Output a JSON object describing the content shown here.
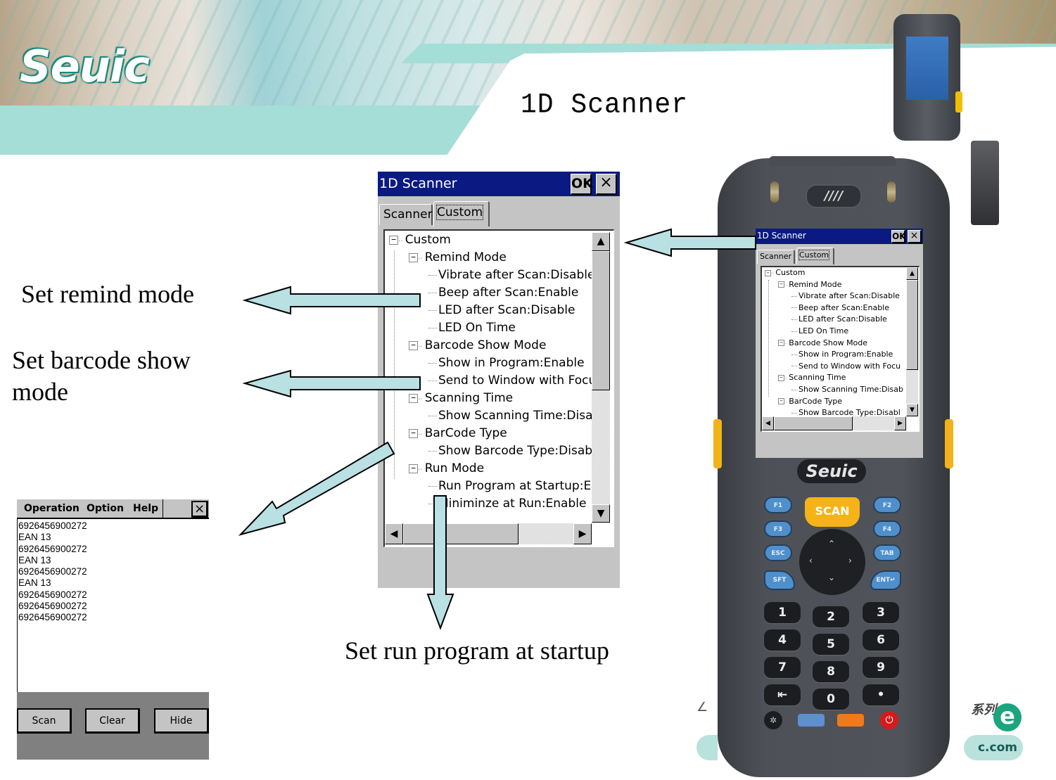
{
  "slide": {
    "logo_text": "Seuic",
    "title": "1D Scanner"
  },
  "main_dialog": {
    "title": "1D Scanner",
    "ok_label": "OK",
    "close_label": "×",
    "tabs": [
      {
        "label": "Scanner",
        "active": false
      },
      {
        "label": "Custom",
        "active": true
      }
    ],
    "tree": [
      {
        "label": "Custom",
        "level": 0,
        "expander": "⊟"
      },
      {
        "label": "Remind Mode",
        "level": 1,
        "expander": "⊟"
      },
      {
        "label": "Vibrate after Scan:Disable",
        "level": 2
      },
      {
        "label": "Beep after Scan:Enable",
        "level": 2
      },
      {
        "label": "LED after Scan:Disable",
        "level": 2
      },
      {
        "label": "LED On Time",
        "level": 2
      },
      {
        "label": "Barcode Show Mode",
        "level": 1,
        "expander": "⊟"
      },
      {
        "label": "Show in Program:Enable",
        "level": 2
      },
      {
        "label": "Send to Window with Focu",
        "level": 2
      },
      {
        "label": "Scanning Time",
        "level": 1,
        "expander": "⊟"
      },
      {
        "label": "Show Scanning Time:Disab",
        "level": 2
      },
      {
        "label": "BarCode Type",
        "level": 1,
        "expander": "⊟"
      },
      {
        "label": "Show Barcode Type:Disabl",
        "level": 2
      },
      {
        "label": "Run Mode",
        "level": 1,
        "expander": "⊟"
      },
      {
        "label": "Run Program at Startup:En",
        "level": 2
      },
      {
        "label": "Miniminze at Run:Enable",
        "level": 2
      }
    ],
    "scroll_up_icon": "▲",
    "scroll_down_icon": "▼",
    "scroll_left_icon": "◀",
    "scroll_right_icon": "▶"
  },
  "device_dialog": {
    "title": "1D Scanner",
    "ok_label": "OK",
    "close_label": "×",
    "tabs": [
      {
        "label": "Scanner",
        "active": false
      },
      {
        "label": "Custom",
        "active": true
      }
    ],
    "tree": [
      {
        "label": "Custom",
        "level": 0,
        "expander": "⊟"
      },
      {
        "label": "Remind Mode",
        "level": 1,
        "expander": "⊟"
      },
      {
        "label": "Vibrate after Scan:Disable",
        "level": 2
      },
      {
        "label": "Beep after Scan:Enable",
        "level": 2
      },
      {
        "label": "LED after Scan:Disable",
        "level": 2
      },
      {
        "label": "LED On Time",
        "level": 2
      },
      {
        "label": "Barcode Show Mode",
        "level": 1,
        "expander": "⊟"
      },
      {
        "label": "Show in Program:Enable",
        "level": 2
      },
      {
        "label": "Send to Window with Focu",
        "level": 2
      },
      {
        "label": "Scanning Time",
        "level": 1,
        "expander": "⊟"
      },
      {
        "label": "Show Scanning Time:Disab",
        "level": 2
      },
      {
        "label": "BarCode Type",
        "level": 1,
        "expander": "⊟"
      },
      {
        "label": "Show Barcode Type:Disabl",
        "level": 2
      }
    ]
  },
  "callouts": {
    "remind": "Set remind mode",
    "barcode_show_line1": "Set barcode show",
    "barcode_show_line2": "mode",
    "run_program": "Set run program at startup"
  },
  "scan_app": {
    "menu": [
      "Operation",
      "Option",
      "Help"
    ],
    "close_label": "×",
    "output_lines": [
      "6926456900272",
      "EAN 13",
      "6926456900272",
      "EAN 13",
      "6926456900272",
      "EAN 13",
      "6926456900272",
      "6926456900272",
      "6926456900272"
    ],
    "buttons": {
      "scan": "Scan",
      "clear": "Clear",
      "hide": "Hide"
    }
  },
  "device": {
    "brand": "Seuic",
    "speaker_glyph": "////",
    "keys": {
      "f1": "F1",
      "f2": "F2",
      "f3": "F3",
      "f4": "F4",
      "esc": "ESC",
      "tab": "TAB",
      "sft": "SFT",
      "ent": "ENT↵",
      "scan": "SCAN",
      "digits": [
        "1",
        "2",
        "3",
        "4",
        "5",
        "6",
        "7",
        "8",
        "9",
        "⇤",
        "0",
        "•"
      ]
    },
    "key_colors": {
      "blue": "#4f8fcc",
      "orange": "#f07a1a",
      "power": "#d41a1a",
      "scan": "#f5b318"
    }
  },
  "footer_brand": {
    "url_fragment": "c.com",
    "e_logo": "e",
    "series_mark": "系列"
  },
  "colors": {
    "arrow_fill": "#b9e0e3",
    "banner_teal": "#a4ded6",
    "wince_title": "#0a1a82",
    "wince_face": "#c4c4c4"
  }
}
